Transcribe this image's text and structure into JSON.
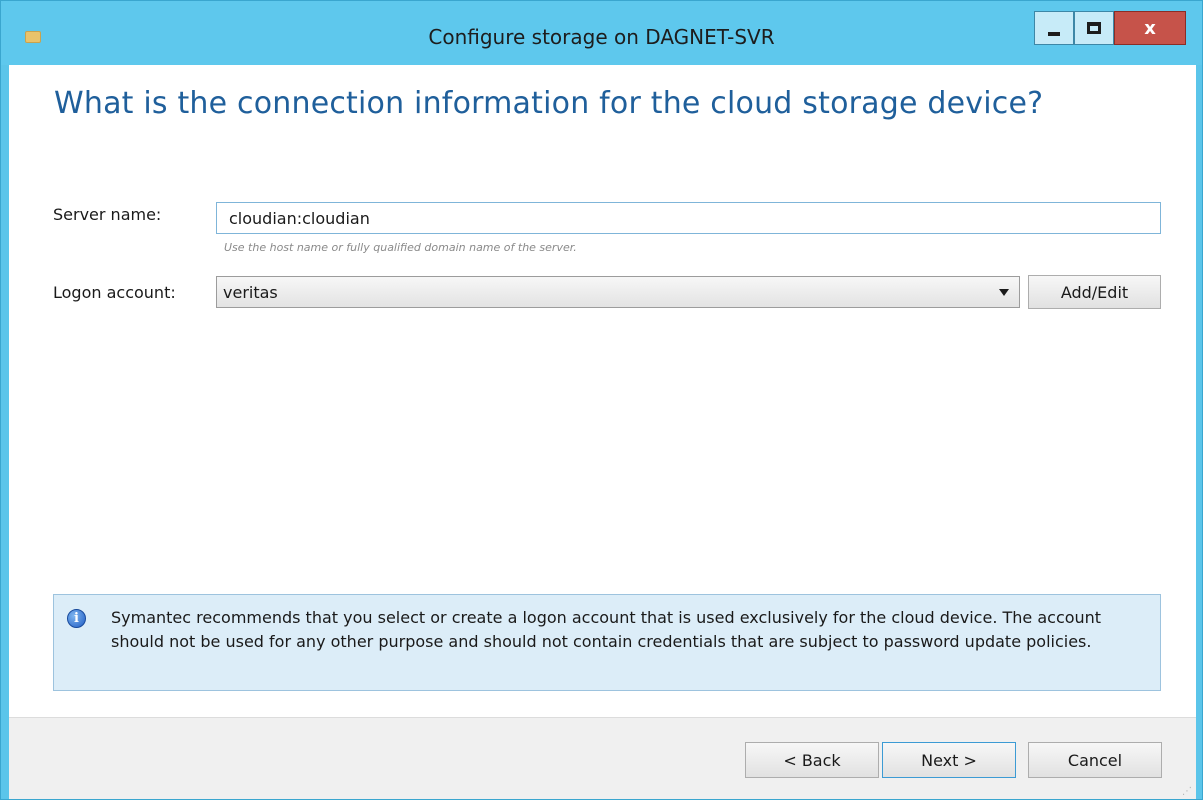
{
  "window": {
    "title": "Configure storage on DAGNET-SVR",
    "close_label": "x"
  },
  "page": {
    "heading": "What is the connection information for the cloud storage device?"
  },
  "form": {
    "server_label": "Server name:",
    "server_value": "cloudian:cloudian",
    "server_hint": "Use the host name or fully qualified domain name of the server.",
    "logon_label": "Logon account:",
    "logon_value": "veritas",
    "add_edit_label": "Add/Edit"
  },
  "info": {
    "icon": "info-icon",
    "text": "Symantec recommends that you select or create a logon account that is used exclusively for the cloud device. The account should not be used for any other purpose and should not contain credentials that are subject to password update policies."
  },
  "footer": {
    "back_label": "< Back",
    "next_label": "Next >",
    "cancel_label": "Cancel"
  }
}
